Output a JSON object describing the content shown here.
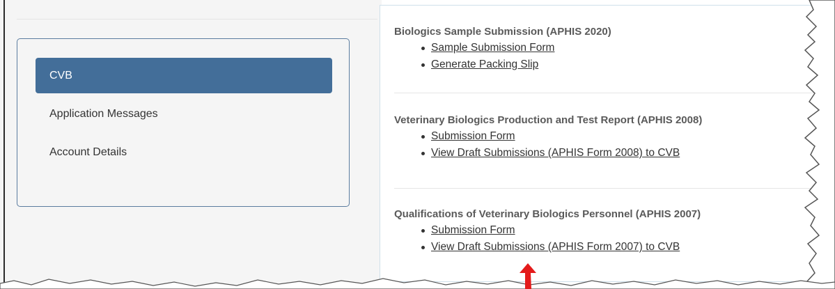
{
  "nav": {
    "items": [
      {
        "label": "CVB",
        "active": true
      },
      {
        "label": "Application Messages",
        "active": false
      },
      {
        "label": "Account Details",
        "active": false
      }
    ]
  },
  "sections": [
    {
      "title": "Biologics Sample Submission (APHIS 2020)",
      "links": [
        "Sample Submission Form",
        "Generate Packing Slip"
      ]
    },
    {
      "title": "Veterinary Biologics Production and Test Report (APHIS 2008)",
      "links": [
        "Submission Form",
        "View Draft Submissions (APHIS Form 2008) to CVB"
      ]
    },
    {
      "title": "Qualifications of Veterinary Biologics Personnel (APHIS 2007)",
      "links": [
        "Submission Form",
        "View Draft Submissions (APHIS Form 2007) to CVB"
      ]
    }
  ],
  "colors": {
    "active_nav": "#436e99",
    "panel_border": "#5b7c9f",
    "arrow": "#e41b1b"
  },
  "icons": {
    "annotation": "red-arrow-icon",
    "bullet": "bullet-icon"
  }
}
